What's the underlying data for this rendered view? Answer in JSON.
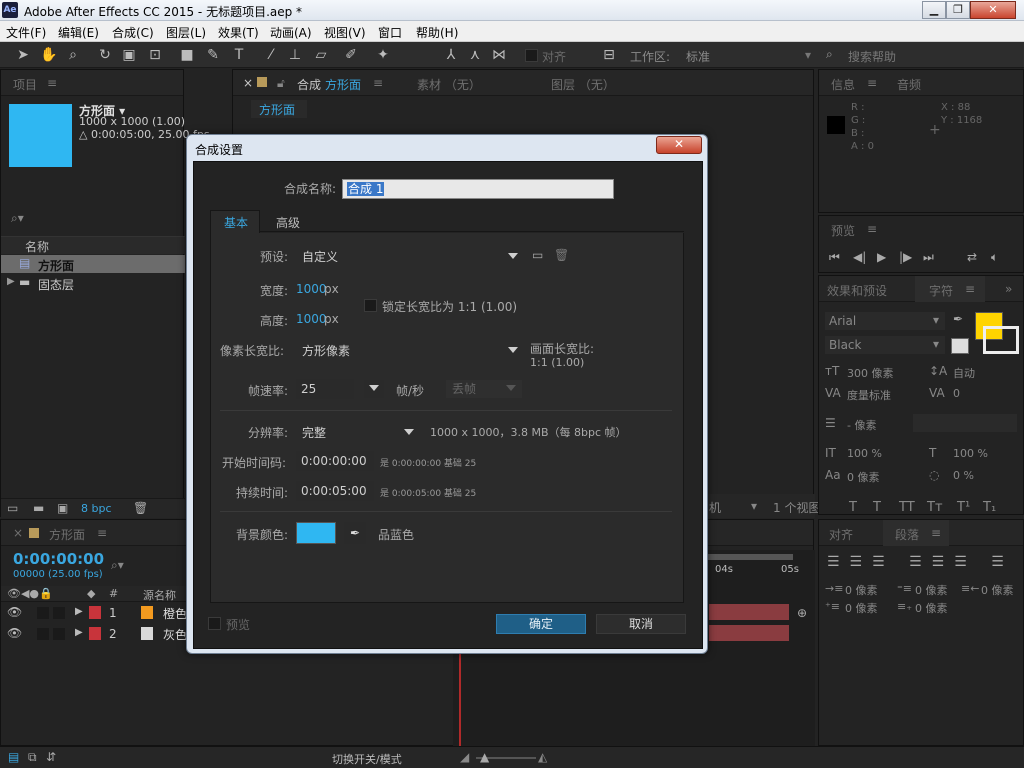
{
  "window": {
    "title": "Adobe After Effects CC 2015 - 无标题项目.aep *",
    "app_icon": "Ae",
    "min": "▁",
    "max": "❐",
    "close": "✕"
  },
  "menu": [
    "文件(F)",
    "编辑(E)",
    "合成(C)",
    "图层(L)",
    "效果(T)",
    "动画(A)",
    "视图(V)",
    "窗口",
    "帮助(H)"
  ],
  "toolbar": {
    "align_label": "对齐",
    "workspace_label": "工作区:",
    "workspace_value": "标准",
    "search_placeholder": "搜索帮助"
  },
  "project": {
    "tab": "项目",
    "item_name": "方形面 ▾",
    "item_size": "1000 x 1000 (1.00)",
    "item_duration": "△ 0:00:05:00, 25.00 fps",
    "col_name": "名称",
    "items": [
      "方形面",
      "固态层"
    ],
    "bpc": "8 bpc",
    "thumb_color": "#2fb7f2"
  },
  "comp_panel": {
    "tab_prefix": "合成",
    "tab_name": "方形面",
    "footage_tab": "素材 （无）",
    "layer_tab": "图层 （无）",
    "sub_tab": "方形面",
    "camera": "机",
    "views": "1 个视图"
  },
  "info": {
    "tab1": "信息",
    "tab2": "音频",
    "r": "R :",
    "g": "G :",
    "b": "B :",
    "a": "A : 0",
    "x": "X : 88",
    "y": "Y : 1168"
  },
  "preview": {
    "tab": "预览"
  },
  "effects": {
    "tab1": "效果和预设",
    "tab2": "字符",
    "font": "Arial",
    "style": "Black",
    "size": "300 像素",
    "leading": "自动",
    "kerning": "度量标准",
    "tracking": "0",
    "stroke": "- 像素",
    "vscale": "100 %",
    "hscale": "100 %",
    "baseline": "0 像素",
    "tsume": "0 %",
    "fill_color": "#ffd400"
  },
  "paragraph": {
    "tab1": "对齐",
    "tab2": "段落",
    "indent": "0 像素"
  },
  "timeline": {
    "tab": "方形面",
    "timecode": "0:00:00:00",
    "frames": "00000 (25.00 fps)",
    "col_source": "源名称",
    "col_num": "#",
    "layers": [
      {
        "num": "1",
        "name": "橙色",
        "color": "#f39a1f"
      },
      {
        "num": "2",
        "name": "灰色",
        "color": "#d8d8d8"
      }
    ],
    "ruler": [
      "04s",
      "05s"
    ],
    "toggle": "切换开关/模式"
  },
  "dialog": {
    "title": "合成设置",
    "close": "✕",
    "name_label": "合成名称:",
    "name_value": "合成 1",
    "tab_basic": "基本",
    "tab_advanced": "高级",
    "preset_label": "预设:",
    "preset_value": "自定义",
    "width_label": "宽度:",
    "width_value": "1000",
    "px": "px",
    "height_label": "高度:",
    "height_value": "1000",
    "lock_label": "锁定长宽比为 1:1 (1.00)",
    "par_label": "像素长宽比:",
    "par_value": "方形像素",
    "far_label": "画面长宽比:",
    "far_value": "1:1 (1.00)",
    "fps_label": "帧速率:",
    "fps_value": "25",
    "fps_unit": "帧/秒",
    "drop": "丢帧",
    "res_label": "分辨率:",
    "res_value": "完整",
    "res_info": "1000 x 1000，3.8 MB（每 8bpc 帧）",
    "start_label": "开始时间码:",
    "start_value": "0:00:00:00",
    "start_info": "是 0:00:00:00  基础 25",
    "dur_label": "持续时间:",
    "dur_value": "0:00:05:00",
    "dur_info": "是 0:00:05:00  基础 25",
    "bg_label": "背景颜色:",
    "bg_name": "品蓝色",
    "bg_color": "#2fb7f2",
    "preview": "预览",
    "ok": "确定",
    "cancel": "取消"
  }
}
